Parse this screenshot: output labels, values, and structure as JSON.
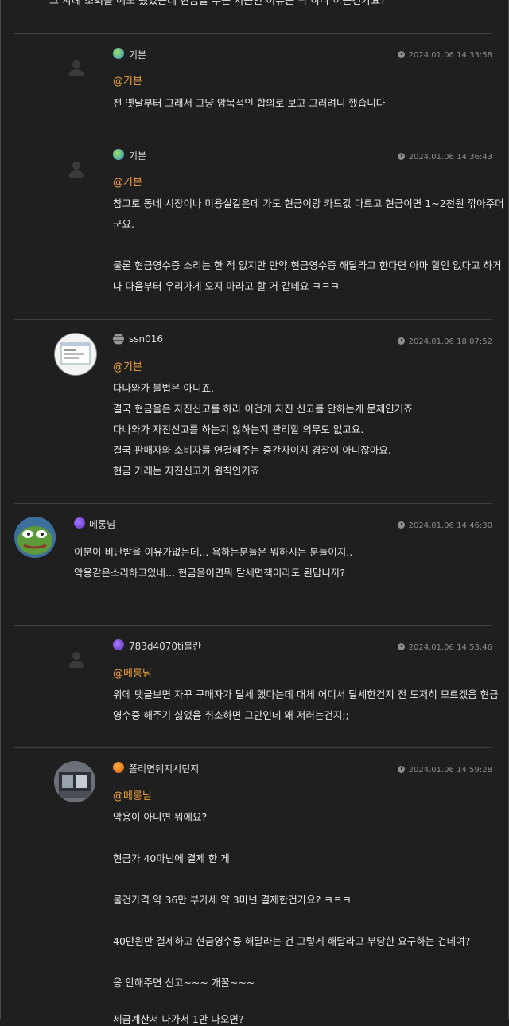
{
  "top_text": "그 사례 조회를 해도 됐었는데 현금을 주는 처음인 이유는 딱 하나 하는건가요?",
  "comments": [
    {
      "nickname": "기븐",
      "time": "2024.01.06 14:33:58",
      "mention": "@기븐",
      "lines": [
        "전 옛날부터 그래서 그냥 암묵적인 합의로 보고 그러려니 했습니다"
      ]
    },
    {
      "nickname": "기븐",
      "time": "2024.01.06 14:36:43",
      "mention": "@기븐",
      "lines": [
        "참고로 동네 시장이나 미용실같은데 가도 현금이랑 카드값 다르고 현금이면 1~2천원 깎아주더",
        "군요.",
        "",
        "물론 현금영수증 소리는 한 적 없지만 만약 현금영수증 해달라고 한다면 아마 할인 없다고 하거",
        "나 다음부터 우리가게 오지 마라고 할 거 같네요 ㅋㅋㅋ"
      ]
    },
    {
      "nickname": "ssn016",
      "time": "2024.01.06 18:07:52",
      "mention": "@기븐",
      "lines": [
        "다나와가 불법은 아니죠.",
        "결국 현금을은 자진신고를 하라 이건게 자진 신고를 안하는게 문제인거죠",
        "다나와가 자진신고를 하는지 않하는지 관리할 의무도 없고요.",
        "결국 판매자와 소비자를 연결해주는 중간자이지 경찰이 아니잖아요.",
        "현금 거래는 자진신고가 원칙인거죠"
      ]
    },
    {
      "nickname": "메롱님",
      "time": "2024.01.06 14:46:30",
      "mention": "",
      "lines": [
        "이분이 비난받을 이유가없는데... 욕하는분들은 뭐하시는 분들이지..",
        "악용같은소리하고있네... 현금을이면뭐 탈세면책이라도 된답니까?"
      ]
    },
    {
      "nickname": "783d4070ti블칸",
      "time": "2024.01.06 14:53:46",
      "mention": "@메롱님",
      "lines": [
        "위에 댓글보면 자꾸 구매자가 탈세 했다는데 대체 어디서 탈세한건지 전 도저히 모르겠음 현금",
        "영수증 해주기 싫었음 취소하면 그만인데 왜 저러는건지;;"
      ]
    },
    {
      "nickname": "쫄리면뒈지시던지",
      "time": "2024.01.06 14:59:28",
      "mention": "@메롱님",
      "lines": [
        "악용이 아니면 뭐에요?",
        "",
        "현금가 40마넌에 결제 한 게",
        "",
        "물건가격 약 36만 부가세 약 3마넌 결제한건가요? ㅋㅋㅋ",
        "",
        "40만원만 결제하고 현금영수증 해달라는 건 그렇게 해달라고 부당한 요구하는 건데여?",
        "",
        "옹 안해주면 신고~~~ 개꿀~~~",
        "",
        "세금계산서 나가서 1만 나오면?"
      ]
    }
  ],
  "colors": {
    "background": "#1f1f1f",
    "mention": "#f0a23c",
    "text": "#e6e6e6",
    "meta": "#8c8c8c"
  }
}
